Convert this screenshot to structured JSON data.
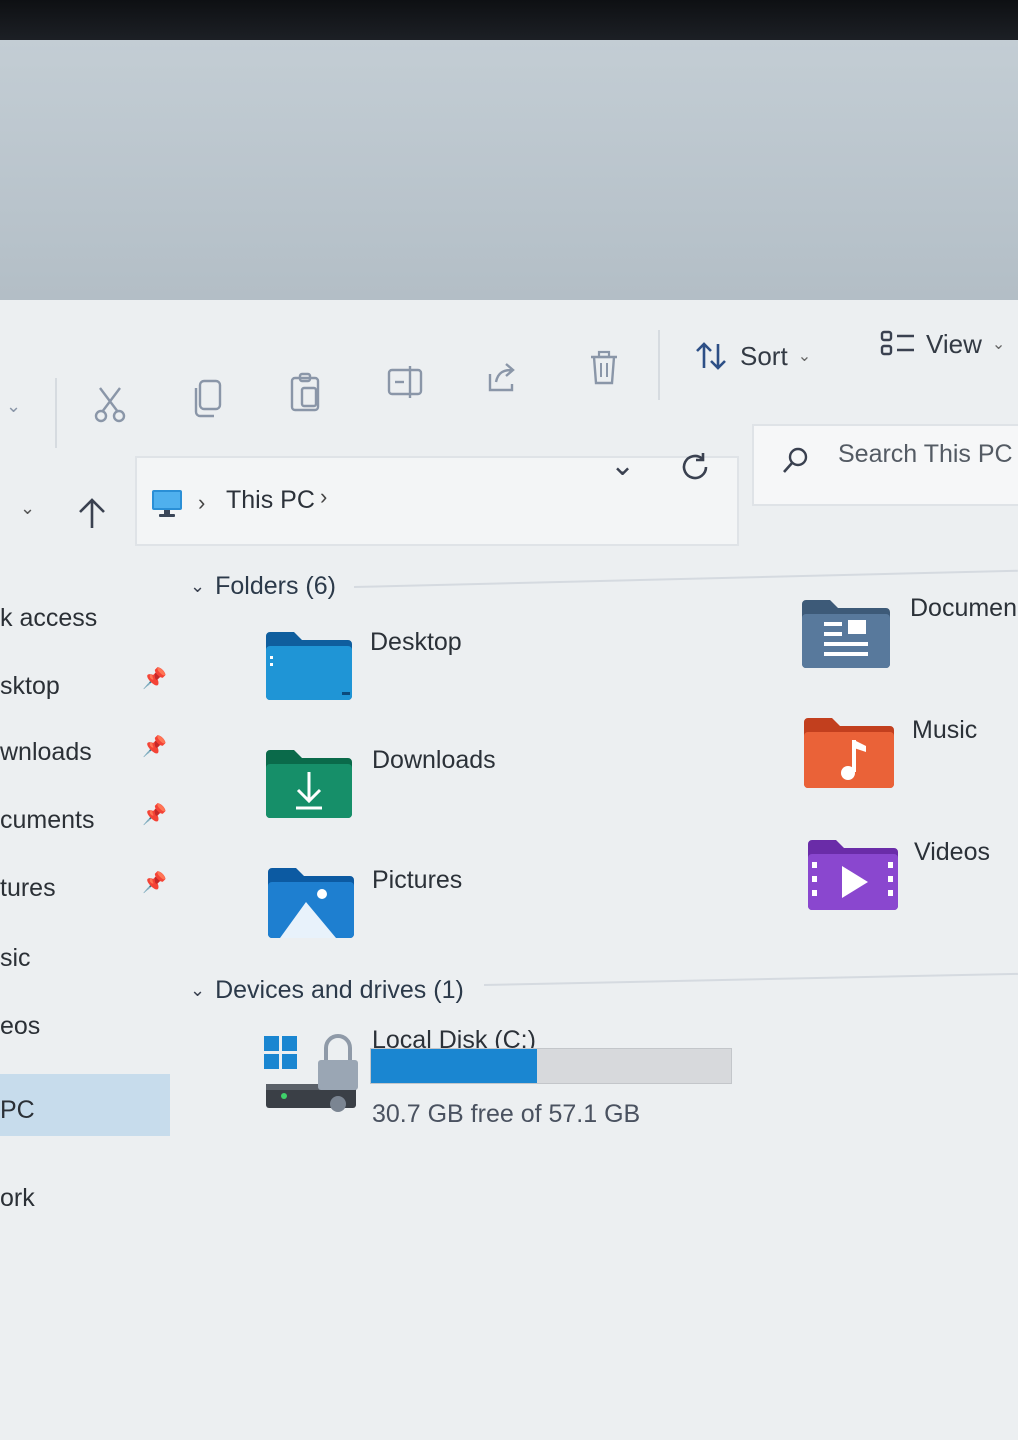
{
  "toolbar": {
    "sort_label": "Sort",
    "view_label": "View",
    "icons": [
      "cut-icon",
      "copy-icon",
      "paste-icon",
      "rename-icon",
      "share-icon",
      "delete-icon"
    ]
  },
  "address": {
    "crumb": "This PC",
    "search_placeholder": "Search This PC"
  },
  "nav": {
    "items": [
      "k access",
      "sktop",
      "wnloads",
      "cuments",
      "tures",
      "sic",
      "eos",
      "PC",
      "ork"
    ]
  },
  "sections": {
    "folders_title": "Folders (6)",
    "devices_title": "Devices and drives (1)"
  },
  "folders": [
    {
      "label": "Desktop",
      "icon": "desktop-folder-icon"
    },
    {
      "label": "Downloads",
      "icon": "downloads-folder-icon"
    },
    {
      "label": "Pictures",
      "icon": "pictures-folder-icon"
    },
    {
      "label": "Documen",
      "icon": "documents-folder-icon"
    },
    {
      "label": "Music",
      "icon": "music-folder-icon"
    },
    {
      "label": "Videos",
      "icon": "videos-folder-icon"
    }
  ],
  "drive": {
    "name": "Local Disk (C:)",
    "free_text": "30.7 GB free of 57.1 GB",
    "used_fraction": 0.46,
    "accent": "#1a86d1"
  }
}
